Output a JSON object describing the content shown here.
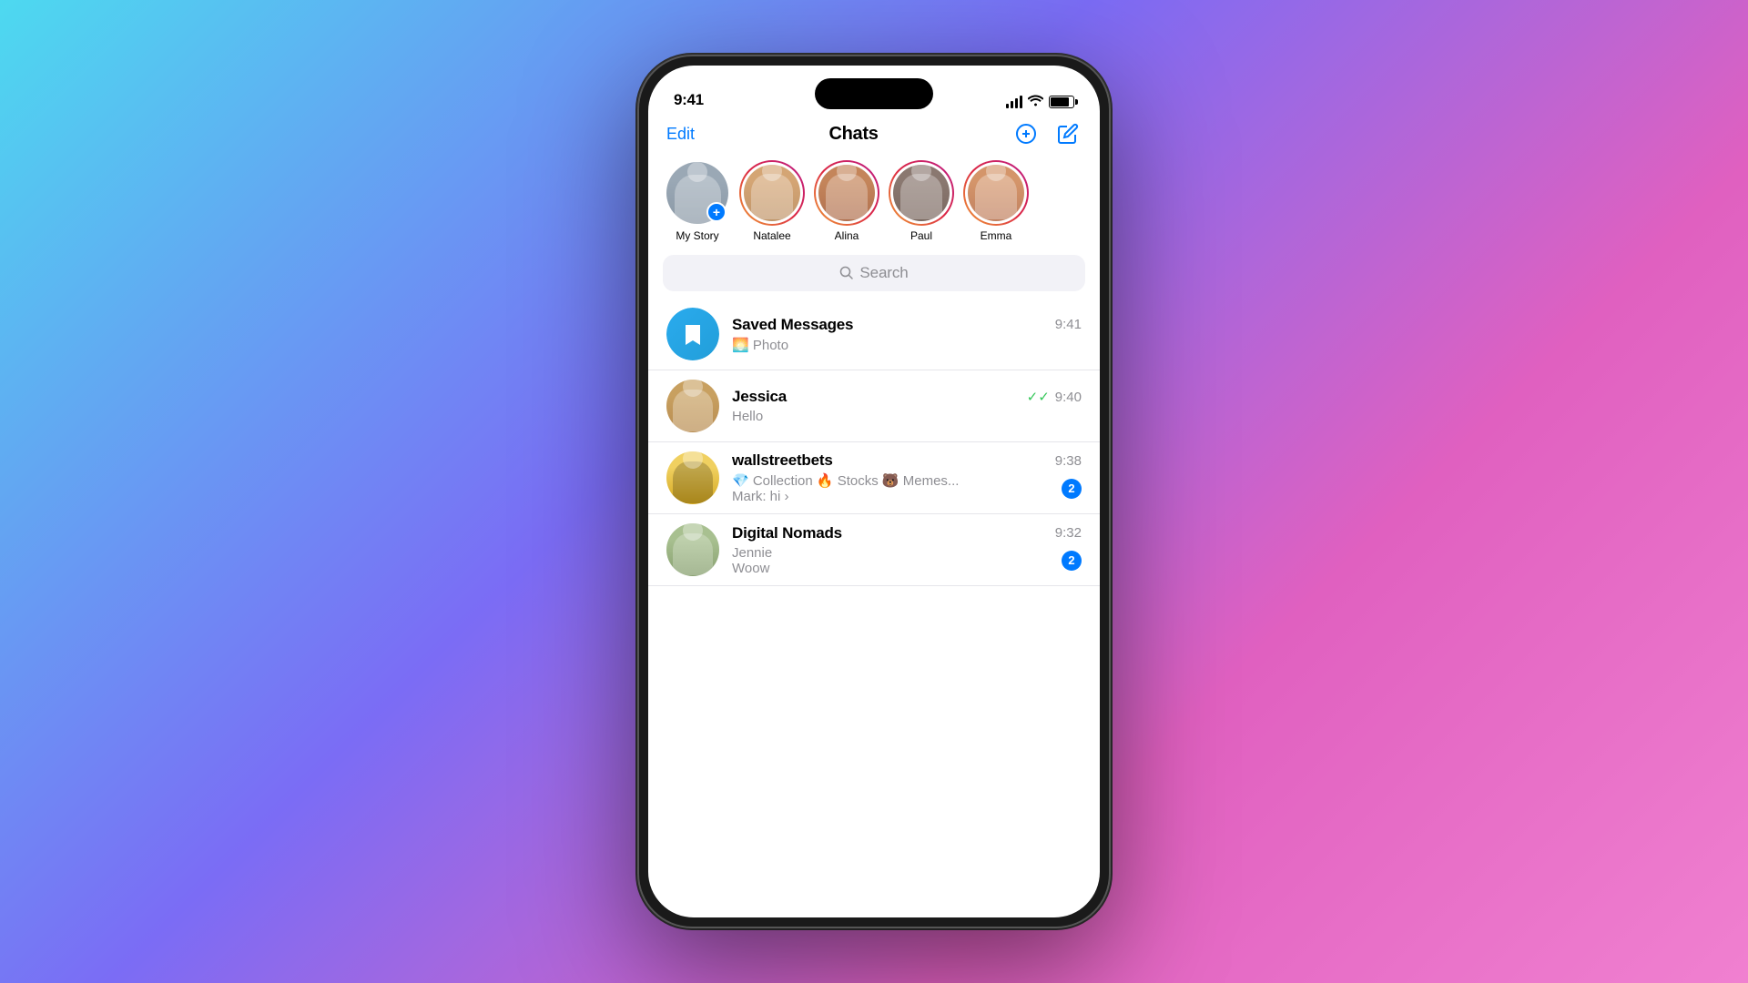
{
  "background": "gradient",
  "phone": {
    "status_bar": {
      "time": "9:41",
      "signal": "●●●●",
      "wifi": "wifi",
      "battery": "battery"
    },
    "header": {
      "edit_label": "Edit",
      "title": "Chats",
      "new_group_icon": "plus-circle-icon",
      "compose_icon": "compose-icon"
    },
    "stories": [
      {
        "id": "my-story",
        "label": "My Story",
        "type": "my"
      },
      {
        "id": "natalee",
        "label": "Natalee",
        "type": "story",
        "color": "#d4a574"
      },
      {
        "id": "alina",
        "label": "Alina",
        "type": "story",
        "color": "#c4855a"
      },
      {
        "id": "paul",
        "label": "Paul",
        "type": "story",
        "color": "#8a7870"
      },
      {
        "id": "emma",
        "label": "Emma",
        "type": "story",
        "color": "#d4956a"
      }
    ],
    "search": {
      "placeholder": "Search"
    },
    "chats": [
      {
        "id": "saved-messages",
        "name": "Saved Messages",
        "preview_line1": "🌅 Photo",
        "preview_line2": "",
        "time": "9:41",
        "unread": 0,
        "type": "saved"
      },
      {
        "id": "jessica",
        "name": "Jessica",
        "preview_line1": "Hello",
        "preview_line2": "",
        "time": "9:40",
        "unread": 0,
        "read": true,
        "type": "person"
      },
      {
        "id": "wallstreetbets",
        "name": "wallstreetbets",
        "preview_line1": "💎 Collection 🔥 Stocks 🐻 Memes...",
        "preview_line2": "Mark: hi ›",
        "time": "9:38",
        "unread": 2,
        "type": "group"
      },
      {
        "id": "digital-nomads",
        "name": "Digital Nomads",
        "preview_line1": "Jennie",
        "preview_line2": "Woow",
        "time": "9:32",
        "unread": 2,
        "type": "group"
      }
    ]
  }
}
